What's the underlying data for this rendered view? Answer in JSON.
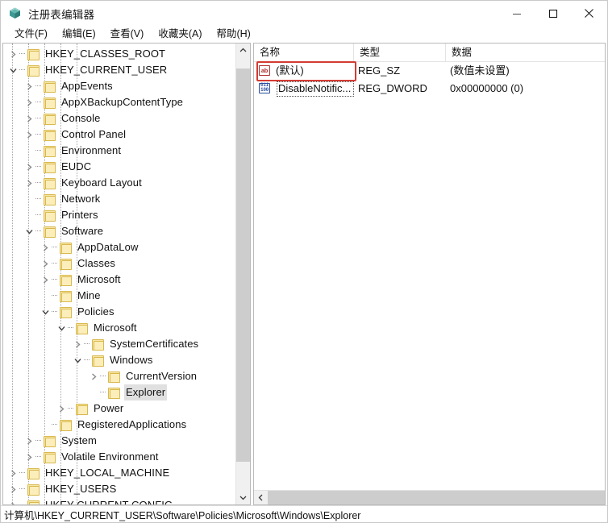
{
  "window": {
    "title": "注册表编辑器",
    "app_icon": "registry-editor-icon",
    "controls": {
      "minimize": "minimize-icon",
      "maximize": "maximize-icon",
      "close": "close-icon"
    }
  },
  "menubar": {
    "items": [
      {
        "label": "文件(F)",
        "name": "menu-file"
      },
      {
        "label": "编辑(E)",
        "name": "menu-edit"
      },
      {
        "label": "查看(V)",
        "name": "menu-view"
      },
      {
        "label": "收藏夹(A)",
        "name": "menu-favorites"
      },
      {
        "label": "帮助(H)",
        "name": "menu-help"
      }
    ]
  },
  "tree": {
    "nodes": [
      {
        "label": "HKEY_CLASSES_ROOT",
        "depth": 0,
        "state": "collapsed"
      },
      {
        "label": "HKEY_CURRENT_USER",
        "depth": 0,
        "state": "expanded"
      },
      {
        "label": "AppEvents",
        "depth": 1,
        "state": "collapsed"
      },
      {
        "label": "AppXBackupContentType",
        "depth": 1,
        "state": "collapsed"
      },
      {
        "label": "Console",
        "depth": 1,
        "state": "collapsed"
      },
      {
        "label": "Control Panel",
        "depth": 1,
        "state": "collapsed"
      },
      {
        "label": "Environment",
        "depth": 1,
        "state": "leaf"
      },
      {
        "label": "EUDC",
        "depth": 1,
        "state": "collapsed"
      },
      {
        "label": "Keyboard Layout",
        "depth": 1,
        "state": "collapsed"
      },
      {
        "label": "Network",
        "depth": 1,
        "state": "leaf"
      },
      {
        "label": "Printers",
        "depth": 1,
        "state": "leaf"
      },
      {
        "label": "Software",
        "depth": 1,
        "state": "expanded"
      },
      {
        "label": "AppDataLow",
        "depth": 2,
        "state": "collapsed"
      },
      {
        "label": "Classes",
        "depth": 2,
        "state": "collapsed"
      },
      {
        "label": "Microsoft",
        "depth": 2,
        "state": "collapsed"
      },
      {
        "label": "Mine",
        "depth": 2,
        "state": "leaf"
      },
      {
        "label": "Policies",
        "depth": 2,
        "state": "expanded"
      },
      {
        "label": "Microsoft",
        "depth": 3,
        "state": "expanded"
      },
      {
        "label": "SystemCertificates",
        "depth": 4,
        "state": "collapsed"
      },
      {
        "label": "Windows",
        "depth": 4,
        "state": "expanded"
      },
      {
        "label": "CurrentVersion",
        "depth": 5,
        "state": "collapsed"
      },
      {
        "label": "Explorer",
        "depth": 5,
        "state": "leaf",
        "selected": true
      },
      {
        "label": "Power",
        "depth": 3,
        "state": "collapsed"
      },
      {
        "label": "RegisteredApplications",
        "depth": 2,
        "state": "leaf"
      },
      {
        "label": "System",
        "depth": 1,
        "state": "collapsed"
      },
      {
        "label": "Volatile Environment",
        "depth": 1,
        "state": "collapsed"
      },
      {
        "label": "HKEY_LOCAL_MACHINE",
        "depth": 0,
        "state": "collapsed"
      },
      {
        "label": "HKEY_USERS",
        "depth": 0,
        "state": "collapsed"
      },
      {
        "label": "HKEY CURRENT CONFIG",
        "depth": 0,
        "state": "collapsed"
      }
    ]
  },
  "values": {
    "columns": [
      {
        "label": "名称",
        "name": "column-name"
      },
      {
        "label": "类型",
        "name": "column-type"
      },
      {
        "label": "数据",
        "name": "column-data"
      }
    ],
    "rows": [
      {
        "name": "(默认)",
        "type": "REG_SZ",
        "data": "(数值未设置)",
        "icon": "string-value-icon",
        "icon_text": "ab",
        "highlighted": false
      },
      {
        "name": "DisableNotific...",
        "type": "REG_DWORD",
        "data": "0x00000000 (0)",
        "icon": "dword-value-icon",
        "icon_text": "011\n100",
        "highlighted": true
      }
    ]
  },
  "statusbar": {
    "path": "计算机\\HKEY_CURRENT_USER\\Software\\Policies\\Microsoft\\Windows\\Explorer"
  },
  "colors": {
    "annotation": "#d33b33",
    "folder": "#f7e6a8",
    "selection": "#e0e0e0",
    "scrollbar_thumb": "#cdcdcd"
  }
}
